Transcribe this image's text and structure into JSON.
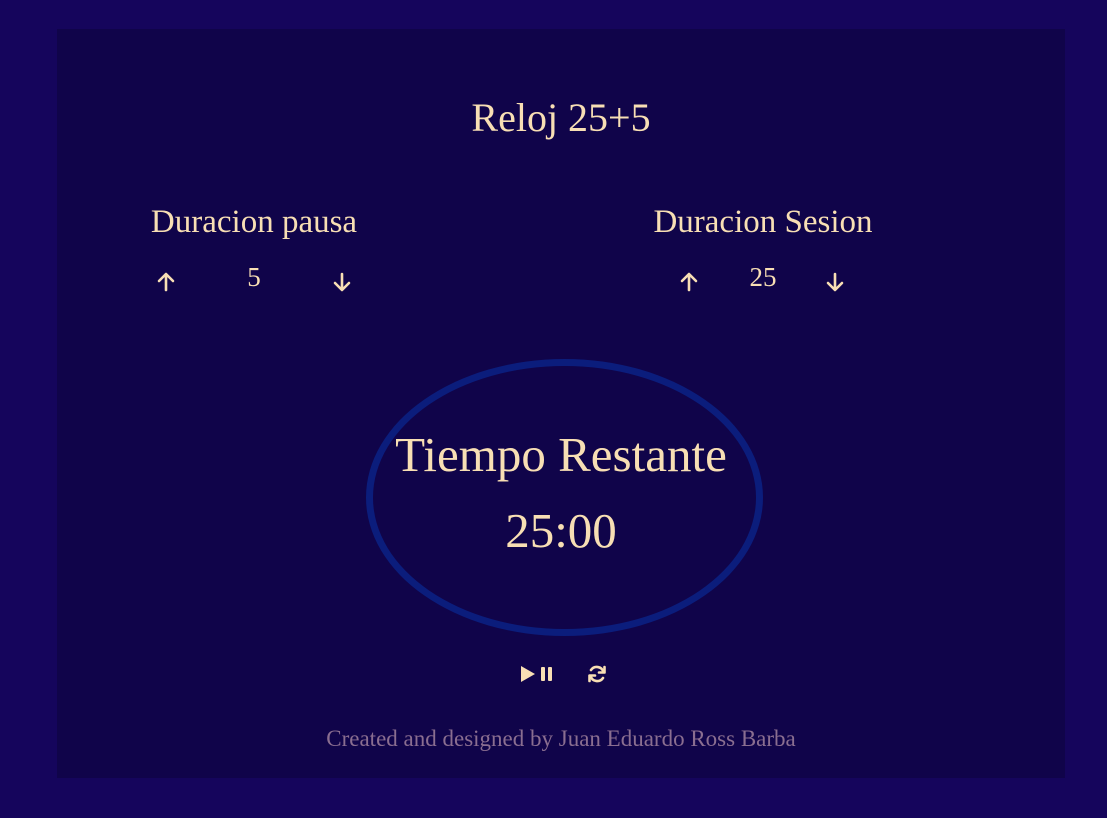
{
  "app": {
    "title": "Reloj 25+5"
  },
  "break_control": {
    "label": "Duracion pausa",
    "value": "5",
    "increment_icon": "arrow-up-icon",
    "decrement_icon": "arrow-down-icon"
  },
  "session_control": {
    "label": "Duracion Sesion",
    "value": "25",
    "increment_icon": "arrow-up-icon",
    "decrement_icon": "arrow-down-icon"
  },
  "timer": {
    "label": "Tiempo Restante",
    "time": "25:00",
    "ring_color": "#0b1d7c"
  },
  "timer_controls": {
    "play_pause_icon": "play-pause-icon",
    "reset_icon": "refresh-icon"
  },
  "footer": {
    "credit": "Created and designed by Juan Eduardo Ross Barba"
  },
  "colors": {
    "outer_background": "#15055c",
    "inner_background": "#10044a",
    "text": "#f8dfb4",
    "credit_text": "#8a6e90"
  }
}
